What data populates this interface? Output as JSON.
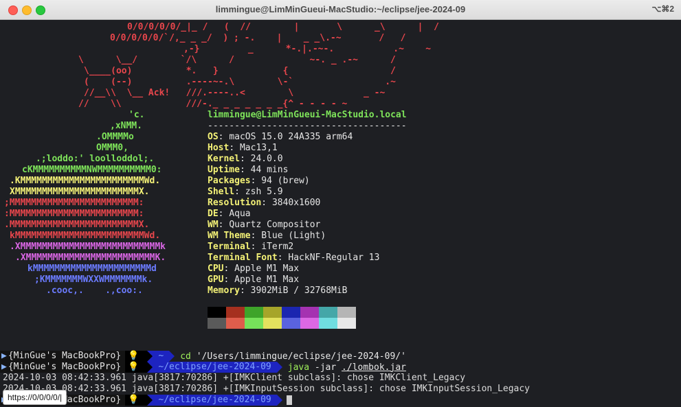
{
  "window": {
    "title": "limmingue@LimMinGueui-MacStudio:~/eclipse/jee-2024-09",
    "shortcut": "⌥⌘2"
  },
  "ascii_top": [
    {
      "text": "0/0/0/0/0/_|_ /   (  //        |       \\      _\\      |  /",
      "color": "#e8464c"
    },
    {
      "text": "0/0/0/0/0/`/,_ _ _/  ) ; -.    |    _ _\\.-~       /   /",
      "color": "#e8464c"
    },
    {
      "text": ",-}         _      *-.|.-~-.           .~    ~",
      "color": "#e8464c"
    },
    {
      "text": "\\      \\__/        `/\\      /              ~-. _ .-~      /",
      "color": "#e8464c"
    },
    {
      "text": "\\____(oo)          *.   }            {                   /",
      "color": "#e8464c"
    },
    {
      "text": "(    (--)          .----~-.\\        \\-`                 .~",
      "color": "#e8464c"
    },
    {
      "text": "//__\\\\  \\__ Ack!   ///.----..<        \\             _ -~",
      "color": "#e8464c"
    },
    {
      "text": "//    \\\\            ///-._ _ _ _ _ _ _{^ - - - - ~",
      "color": "#e8464c"
    }
  ],
  "apple_logo": [
    {
      "text": "'c.",
      "color": "#7ee35a"
    },
    {
      "text": ",xNMM.",
      "color": "#7ee35a"
    },
    {
      "text": ".OMMMMo",
      "color": "#7ee35a"
    },
    {
      "text": "OMMM0,",
      "color": "#7ee35a"
    },
    {
      "text": ".;loddo:' loolloddol;.",
      "color": "#7ee35a"
    },
    {
      "text": "cKMMMMMMMMMMNWMMMMMMMMMM0:",
      "color": "#7ee35a"
    },
    {
      "text": ".KMMMMMMMMMMMMMMMMMMMMMMMWd.",
      "color": "#f4f277"
    },
    {
      "text": "XMMMMMMMMMMMMMMMMMMMMMMMX.",
      "color": "#f4f277"
    },
    {
      "text": ";MMMMMMMMMMMMMMMMMMMMMMMM:",
      "color": "#e8464c"
    },
    {
      "text": ":MMMMMMMMMMMMMMMMMMMMMMMM:",
      "color": "#e8464c"
    },
    {
      "text": ".MMMMMMMMMMMMMMMMMMMMMMMMX.",
      "color": "#e8464c"
    },
    {
      "text": "kMMMMMMMMMMMMMMMMMMMMMMMMWd.",
      "color": "#e8464c"
    },
    {
      "text": ".XMMMMMMMMMMMMMMMMMMMMMMMMMMk",
      "color": "#d966e4"
    },
    {
      "text": ".XMMMMMMMMMMMMMMMMMMMMMMMMK.",
      "color": "#d966e4"
    },
    {
      "text": "kMMMMMMMMMMMMMMMMMMMMMMd",
      "color": "#6b7bff"
    },
    {
      "text": ";KMMMMMMMWXXWMMMMMMMk.",
      "color": "#6b7bff"
    },
    {
      "text": ".cooc,.    .,coo:.",
      "color": "#6b7bff"
    }
  ],
  "system": {
    "header": "limmingue@LimMinGueui-MacStudio.local",
    "separator": "-------------------------------------",
    "fields": [
      {
        "key": "OS",
        "value": "macOS 15.0 24A335 arm64"
      },
      {
        "key": "Host",
        "value": "Mac13,1"
      },
      {
        "key": "Kernel",
        "value": "24.0.0"
      },
      {
        "key": "Uptime",
        "value": "44 mins"
      },
      {
        "key": "Packages",
        "value": "94 (brew)"
      },
      {
        "key": "Shell",
        "value": "zsh 5.9"
      },
      {
        "key": "Resolution",
        "value": "3840x1600"
      },
      {
        "key": "DE",
        "value": "Aqua"
      },
      {
        "key": "WM",
        "value": "Quartz Compositor"
      },
      {
        "key": "WM Theme",
        "value": "Blue (Light)"
      },
      {
        "key": "Terminal",
        "value": "iTerm2"
      },
      {
        "key": "Terminal Font",
        "value": "HackNF-Regular 13"
      },
      {
        "key": "CPU",
        "value": "Apple M1 Max"
      },
      {
        "key": "GPU",
        "value": "Apple M1 Max"
      },
      {
        "key": "Memory",
        "value": "3902MiB / 32768MiB"
      }
    ],
    "palette_row1": [
      "#000000",
      "#a5301f",
      "#3ea42a",
      "#a6a52a",
      "#1b26b0",
      "#a532b1",
      "#44a7a8",
      "#b5b5b5"
    ],
    "palette_row2": [
      "#5a5a5a",
      "#df5d4c",
      "#76e25a",
      "#e3e25e",
      "#5a63df",
      "#dc68e4",
      "#70dde0",
      "#e8e8e8"
    ]
  },
  "prompts": [
    {
      "host": "{MinGue's MacBookPro}",
      "dir": "~",
      "cmd_prefix": "cd ",
      "cmd_arg": "'/Users/limmingue/eclipse/jee-2024-09/'",
      "cmd_arg2": ""
    },
    {
      "host": "{MinGue's MacBookPro}",
      "dir": "~/eclipse/jee-2024-09",
      "cmd_prefix": "java ",
      "cmd_arg": "-jar ",
      "cmd_arg2": "./lombok.jar"
    }
  ],
  "logs": [
    "2024-10-03 08:42:33.961 java[3817:70286] +[IMKClient subclass]: chose IMKClient_Legacy",
    "2024-10-03 08:42:33.961 java[3817:70286] +[IMKInputSession subclass]: chose IMKInputSession_Legacy"
  ],
  "last_prompt": {
    "host": "{MinGue's MacBookPro}",
    "dir": "~/eclipse/jee-2024-09"
  },
  "tooltip": "https://0/0/0/0/|"
}
